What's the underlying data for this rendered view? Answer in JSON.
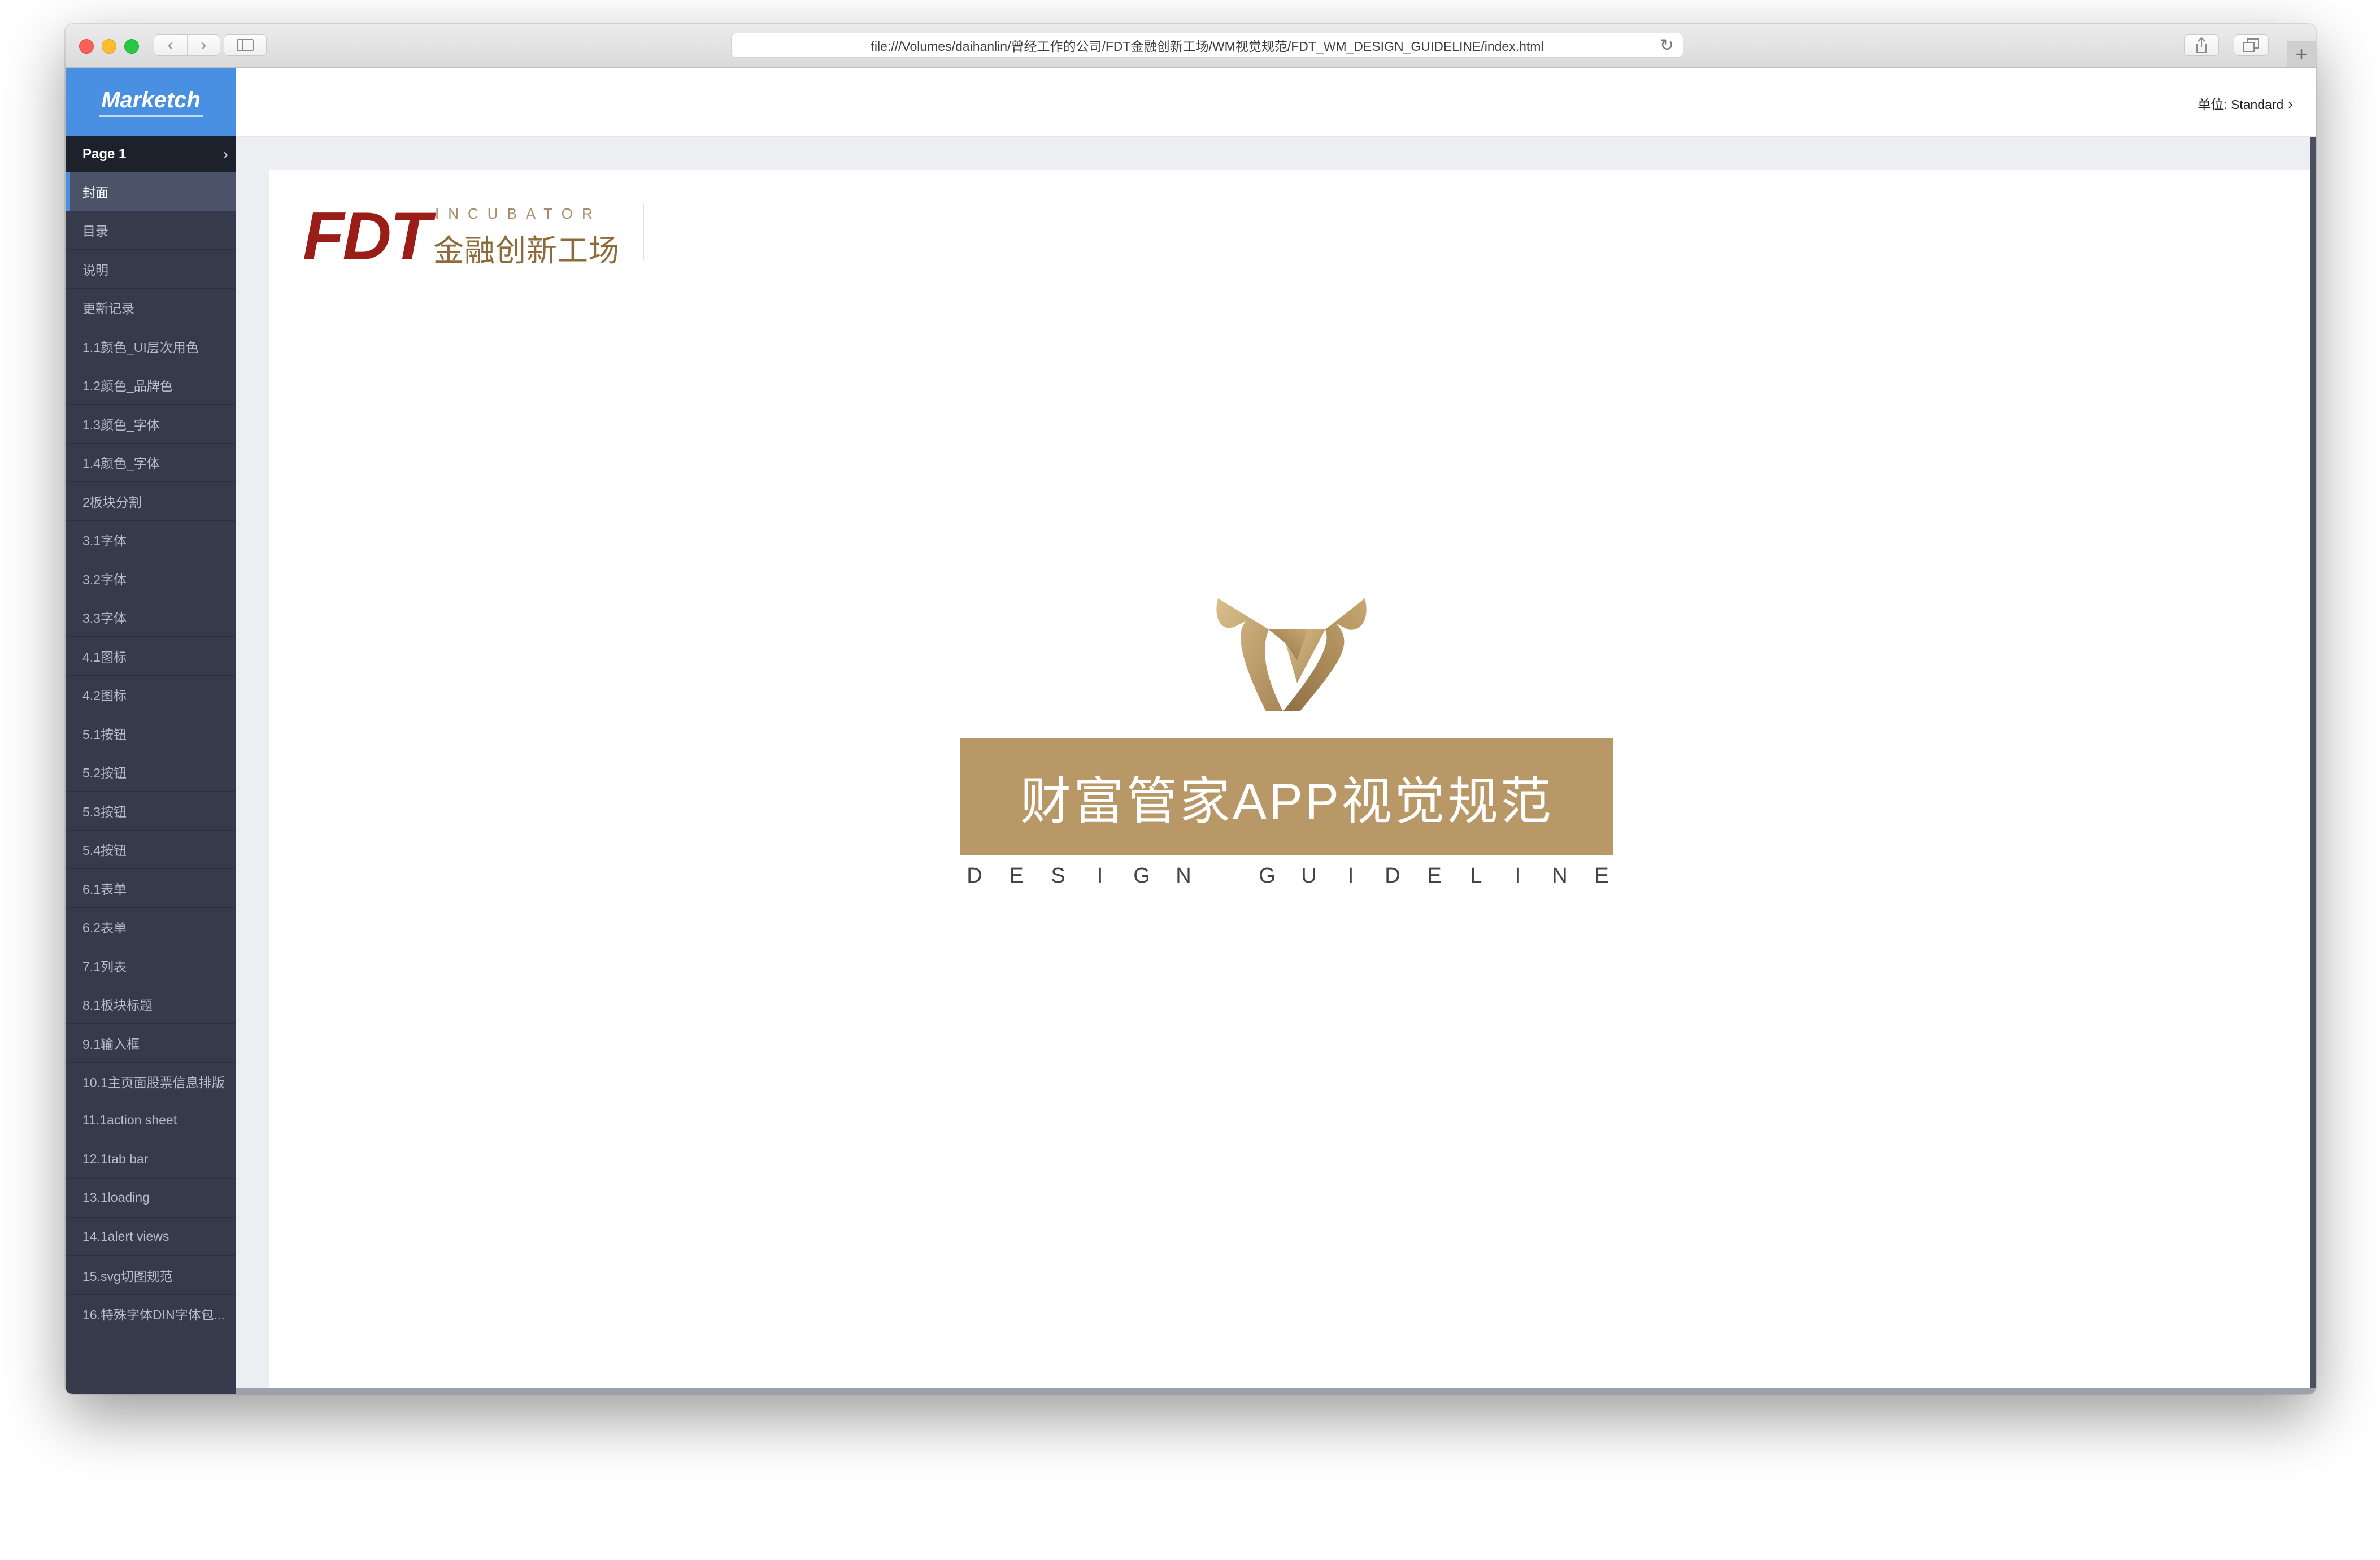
{
  "browser": {
    "url": "file:///Volumes/daihanlin/曾经工作的公司/FDT金融创新工场/WM视觉规范/FDT_WM_DESIGN_GUIDELINE/index.html",
    "back_glyph": "‹",
    "forward_glyph": "›",
    "reload_glyph": "↻",
    "new_tab_glyph": "+"
  },
  "app": {
    "brand": "Marketch",
    "page_label": "Page 1",
    "page_chevron": "›",
    "unit_label": "单位: Standard",
    "unit_chevron": "›"
  },
  "nav": {
    "items": [
      "封面",
      "目录",
      "说明",
      "更新记录",
      "1.1颜色_UI层次用色",
      "1.2颜色_品牌色",
      "1.3颜色_字体",
      "1.4颜色_字体",
      "2板块分割",
      "3.1字体",
      "3.2字体",
      "3.3字体",
      "4.1图标",
      "4.2图标",
      "5.1按钮",
      "5.2按钮",
      "5.3按钮",
      "5.4按钮",
      "6.1表单",
      "6.2表单",
      "7.1列表",
      "8.1板块标题",
      "9.1输入框",
      "10.1主页面股票信息排版",
      "11.1action sheet",
      "12.1tab bar",
      "13.1loading",
      "14.1alert views",
      "15.svg切图规范",
      "16.特殊字体DIN字体包..."
    ],
    "active_index": 0
  },
  "artboard": {
    "logo_fdt": "FDT",
    "logo_incubator": "INCUBATOR",
    "logo_cn": "金融创新工场",
    "title": "财富管家APP视觉规范",
    "subtitle_letters": [
      "D",
      "E",
      "S",
      "I",
      "G",
      "N",
      " ",
      "G",
      "U",
      "I",
      "D",
      "E",
      "L",
      "I",
      "N",
      "E"
    ]
  },
  "colors": {
    "brand_blue": "#4a90e2",
    "sidebar_bg": "#353b4b",
    "fdt_red": "#9b1d18",
    "gold": "#b89867"
  }
}
